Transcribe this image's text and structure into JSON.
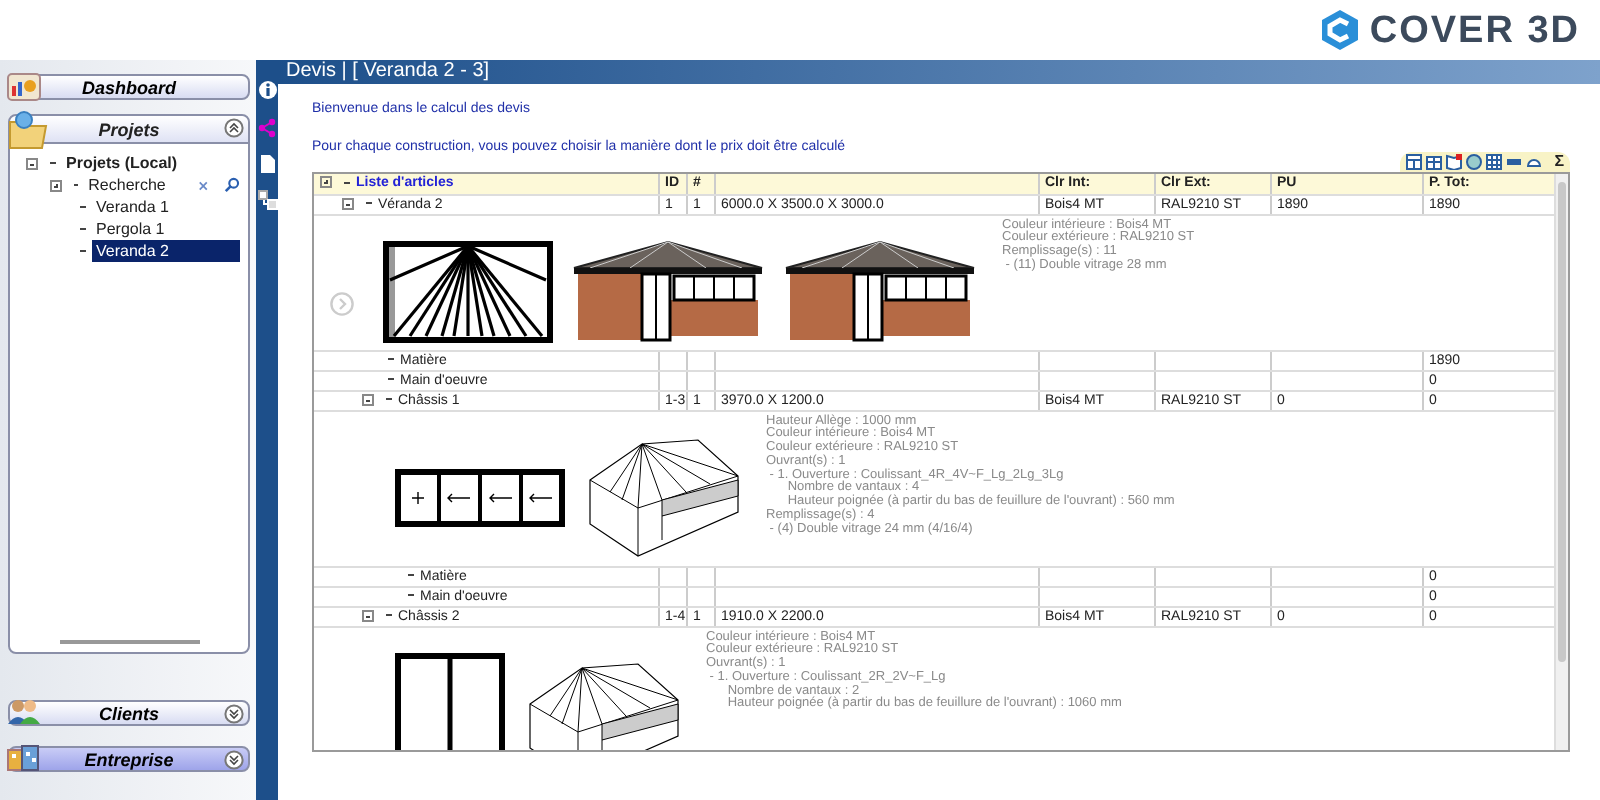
{
  "brand": {
    "name": "COVER 3D"
  },
  "sidebar": {
    "dashboard": {
      "label": "Dashboard"
    },
    "projects": {
      "title": "Projets",
      "expanded": true,
      "tree": [
        {
          "label": "Projets (Local)",
          "expanded": true,
          "selected": false,
          "children": [
            {
              "label": "Recherche",
              "kind": "search",
              "expanded": false,
              "selected": false
            },
            {
              "label": "Veranda 1",
              "selected": false
            },
            {
              "label": "Pergola 1",
              "selected": false
            },
            {
              "label": "Veranda 2",
              "selected": true
            }
          ]
        }
      ]
    },
    "clients": {
      "label": "Clients",
      "expanded": false
    },
    "company": {
      "label": "Entreprise",
      "expanded": false
    }
  },
  "panel": {
    "title": "Devis | [ Veranda 2 - 3]",
    "intro": "Bienvenue dans le calcul des devis",
    "instruction": "Pour chaque construction, vous pouvez choisir la manière dont le prix doit être calculé",
    "sum_label": "Σ"
  },
  "table": {
    "columns": [
      {
        "title": "Liste d'articles"
      },
      {
        "title": "ID"
      },
      {
        "title": "#"
      },
      {},
      {
        "title": "Clr Int:"
      },
      {
        "title": "Clr Ext:"
      },
      {
        "title": "PU"
      },
      {
        "title": "P. Tot:"
      }
    ],
    "header_expanded": false,
    "rows": [
      {
        "label": "Véranda 2",
        "id": "1",
        "count": "1",
        "dimensions": "6000.0 X  3500.0 X  3000.0",
        "clr_int": "Bois4 MT",
        "clr_ext": "RAL9210 ST",
        "pu": "1890",
        "total": "1890",
        "expanded": true,
        "drawings": [
          {
            "kind": "plan"
          },
          {
            "kind": "house"
          },
          {
            "kind": "house"
          }
        ],
        "details": [
          "Couleur intérieure : Bois4 MT",
          "Couleur extérieure : RAL9210 ST",
          "Remplissage(s) : 11",
          " - (11) Double vitrage 28 mm"
        ],
        "children": [
          {
            "label": "Matière",
            "total": "1890"
          },
          {
            "label": "Main d'oeuvre",
            "total": "0"
          },
          {
            "label": "Châssis 1",
            "id": "1-3",
            "count": "1",
            "dimensions": "3970.0 X  1200.0",
            "clr_int": "Bois4 MT",
            "clr_ext": "RAL9210 ST",
            "pu": "0",
            "total": "0",
            "expanded": true,
            "drawings": [
              {
                "kind": "window"
              },
              {
                "kind": "wireframe"
              }
            ],
            "details": [
              "Hauteur Allège : 1000 mm",
              "Couleur intérieure : Bois4 MT",
              "Couleur extérieure : RAL9210 ST",
              "Ouvrant(s) : 1",
              " - 1. Ouverture : Coulissant_4R_4V~F_Lg_2Lg_3Lg",
              "      Nombre de vantaux : 4",
              "      Hauteur poignée (à partir du bas de feuillure de l'ouvrant) : 560 mm",
              "Remplissage(s) : 4",
              " - (4) Double vitrage 24 mm (4/16/4)"
            ],
            "children": [
              {
                "label": "Matière",
                "total": "0"
              },
              {
                "label": "Main d'oeuvre",
                "total": "0"
              }
            ]
          },
          {
            "label": "Châssis 2",
            "id": "1-4",
            "count": "1",
            "dimensions": "1910.0 X  2200.0",
            "clr_int": "Bois4 MT",
            "clr_ext": "RAL9210 ST",
            "pu": "0",
            "total": "0",
            "expanded": true,
            "drawings": [
              {
                "kind": "door"
              },
              {
                "kind": "wireframe"
              }
            ],
            "details": [
              "Couleur intérieure : Bois4 MT",
              "Couleur extérieure : RAL9210 ST",
              "Ouvrant(s) : 1",
              " - 1. Ouverture : Coulissant_2R_2V~F_Lg",
              "      Nombre de vantaux : 2",
              "      Hauteur poignée (à partir du bas de feuillure de l'ouvrant) : 1060 mm"
            ]
          }
        ]
      }
    ]
  }
}
